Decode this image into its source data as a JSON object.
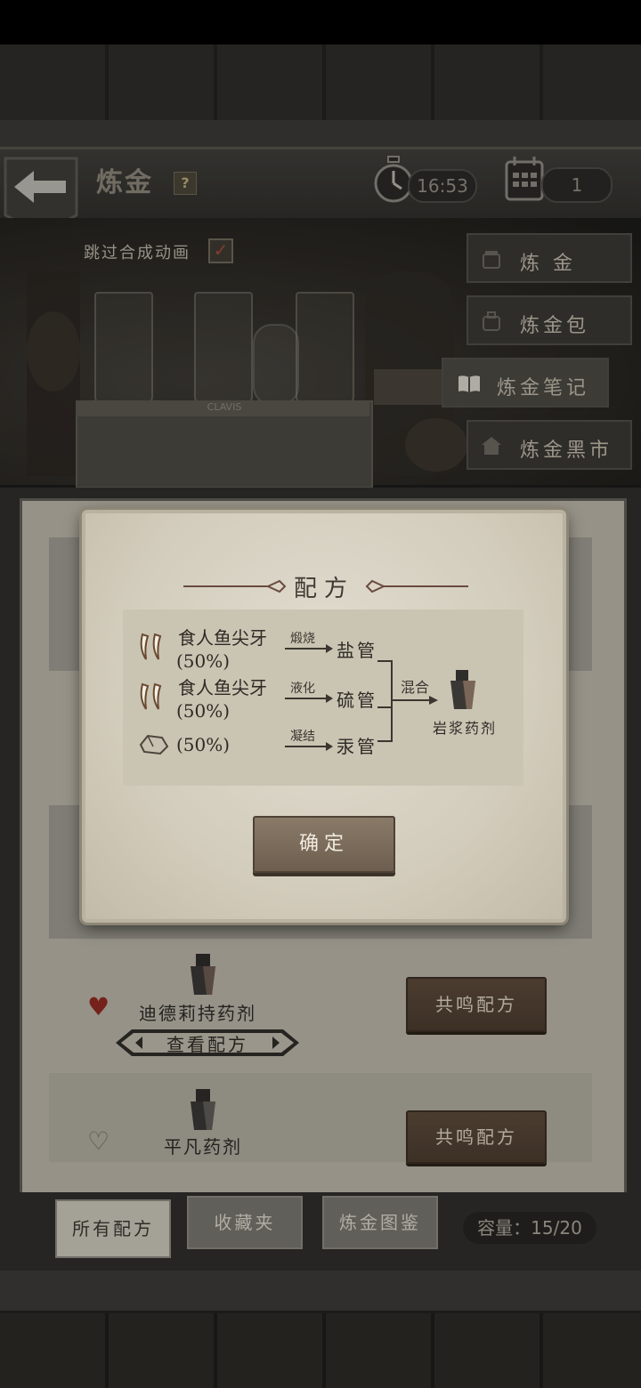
{
  "header": {
    "title": "炼金",
    "help_label": "?",
    "timer": "16:53",
    "day": "1"
  },
  "scene": {
    "skip_animation_label": "跳过合成动画",
    "skip_checked_mark": "✓",
    "rack_label": "CLAVIS"
  },
  "side_menu": [
    {
      "label": "炼  金",
      "icon": "jar-icon"
    },
    {
      "label": "炼金包",
      "icon": "bag-icon"
    },
    {
      "label": "炼金笔记",
      "icon": "book-icon"
    },
    {
      "label": "炼金黑市",
      "icon": "house-icon"
    }
  ],
  "recipe_list": [
    {
      "name": "迪德莉持药剂",
      "favorite": true,
      "view_label": "查看配方",
      "action_label": "共鸣配方"
    },
    {
      "name": "平凡药剂",
      "favorite": false,
      "action_label": "共鸣配方"
    }
  ],
  "tabs": [
    {
      "label": "所有配方",
      "active": true
    },
    {
      "label": "收藏夹",
      "active": false
    },
    {
      "label": "炼金图鉴",
      "active": false
    }
  ],
  "capacity": "容量：15/20",
  "modal": {
    "title": "配方",
    "ingredients": [
      {
        "name": "食人鱼尖牙",
        "ratio": "(50%)",
        "process": "煅烧",
        "tube": "盐管"
      },
      {
        "name": "食人鱼尖牙",
        "ratio": "(50%)",
        "process": "液化",
        "tube": "硫管"
      },
      {
        "name": "",
        "ratio": "(50%)",
        "process": "凝结",
        "tube": "汞管"
      }
    ],
    "mix_label": "混合",
    "result": "岩浆药剂",
    "confirm_label": "确定"
  }
}
